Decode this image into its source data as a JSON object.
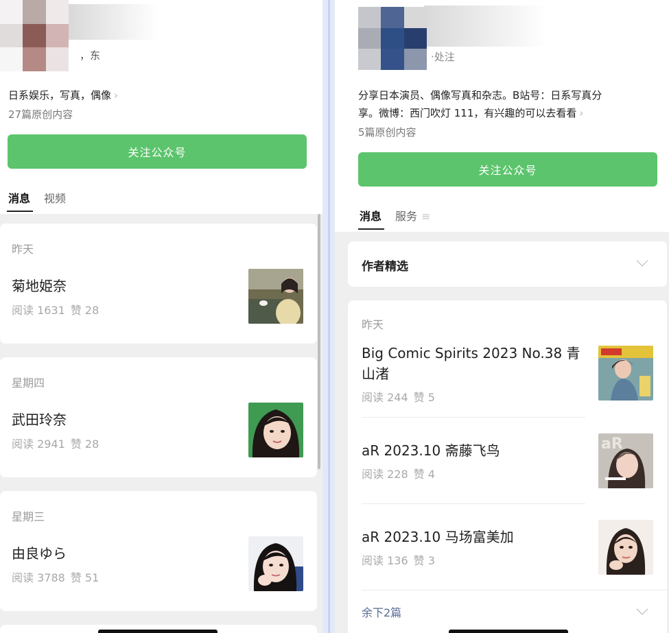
{
  "left": {
    "region_fragment": "，东",
    "bio": "日系娱乐，写真，偶像",
    "original_count": "27篇原创内容",
    "follow_label": "关注公众号",
    "tabs": [
      "消息",
      "视频"
    ],
    "posts": [
      {
        "day": "昨天",
        "title": "菊地姫奈",
        "reads": "阅读 1631",
        "likes": "赞 28"
      },
      {
        "day": "星期四",
        "title": "武田玲奈",
        "reads": "阅读 2941",
        "likes": "赞 28"
      },
      {
        "day": "星期三",
        "title": "由良ゆら",
        "reads": "阅读 3788",
        "likes": "赞 51"
      }
    ]
  },
  "right": {
    "status_fragment": "·处注",
    "bio_line1": "分享日本演员、偶像写真和杂志。B站号：日系写真分",
    "bio_line2": "享。微博：西门吹灯 111，有兴趣的可以去看看",
    "original_count": "5篇原创内容",
    "follow_label": "关注公众号",
    "tabs": [
      "消息",
      "服务"
    ],
    "tab_menu_icon": "≡",
    "picks_title": "作者精选",
    "day": "昨天",
    "posts": [
      {
        "title": "Big Comic Spirits 2023 No.38 青山渚",
        "reads": "阅读 244",
        "likes": "赞 5"
      },
      {
        "title": "aR 2023.10 斋藤飞鸟",
        "reads": "阅读 228",
        "likes": "赞 4"
      },
      {
        "title": "aR 2023.10 马场富美加",
        "reads": "阅读 136",
        "likes": "赞 3"
      }
    ],
    "remaining": "余下2篇"
  },
  "colors": {
    "follow_green": "#5cc46c",
    "link_blue": "#576b95",
    "feed_gray": "#efefef"
  },
  "icons": {
    "bio_more": "chevron-right-icon",
    "collapse": "chevron-down-icon",
    "tab_menu": "menu-icon"
  }
}
